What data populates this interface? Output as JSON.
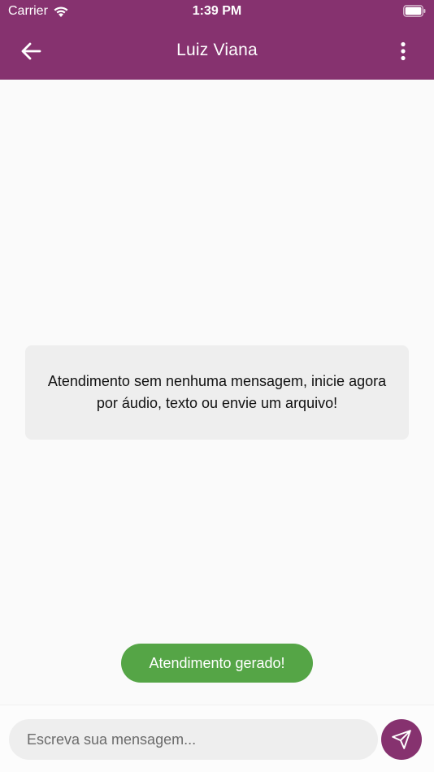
{
  "status_bar": {
    "carrier": "Carrier",
    "time": "1:39 PM",
    "wifi_icon": "wifi-icon",
    "battery_icon": "battery-icon"
  },
  "app_bar": {
    "title": "Luiz Viana",
    "back_icon": "arrow-left-icon",
    "menu_icon": "more-vertical-icon",
    "color": "#86326f"
  },
  "chat": {
    "empty_message": "Atendimento sem nenhuma mensagem, inicie agora por áudio, texto ou envie um arquivo!"
  },
  "toast": {
    "text": "Atendimento gerado!",
    "color": "#55a546"
  },
  "composer": {
    "placeholder": "Escreva sua mensagem...",
    "value": "",
    "send_icon": "send-icon"
  }
}
